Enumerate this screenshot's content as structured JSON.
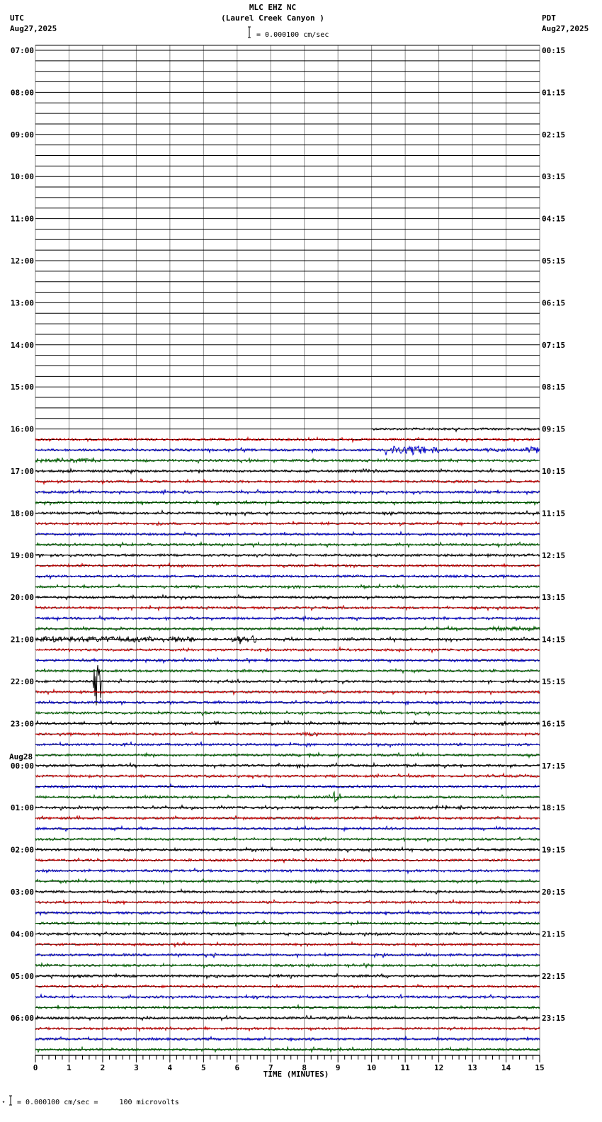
{
  "header": {
    "title": "MLC EHZ NC",
    "subtitle": "(Laurel Creek Canyon )",
    "scale": "= 0.000100 cm/sec",
    "left_tz": "UTC",
    "left_date": "Aug27,2025",
    "right_tz": "PDT",
    "right_date": "Aug27,2025"
  },
  "footer": {
    "scale_note": "= 0.000100 cm/sec =     100 microvolts",
    "mark": "⋆"
  },
  "chart_data": {
    "type": "line",
    "title": "MLC EHZ NC (Laurel Creek Canyon )",
    "xlabel": "TIME (MINUTES)",
    "xlim": [
      0,
      15
    ],
    "x_ticks": [
      "0",
      "1",
      "2",
      "3",
      "4",
      "5",
      "6",
      "7",
      "8",
      "9",
      "10",
      "11",
      "12",
      "13",
      "14",
      "15"
    ],
    "rows_per_hour": 4,
    "utc_labels": [
      "07:00",
      "08:00",
      "09:00",
      "10:00",
      "11:00",
      "12:00",
      "13:00",
      "14:00",
      "15:00",
      "16:00",
      "17:00",
      "18:00",
      "19:00",
      "20:00",
      "21:00",
      "22:00",
      "23:00",
      "00:00",
      "01:00",
      "02:00",
      "03:00",
      "04:00",
      "05:00",
      "06:00"
    ],
    "date_change_label": "Aug28",
    "pdt_labels": [
      "00:15",
      "01:15",
      "02:15",
      "03:15",
      "04:15",
      "05:15",
      "06:15",
      "07:15",
      "08:15",
      "09:15",
      "10:15",
      "11:15",
      "12:15",
      "13:15",
      "14:15",
      "15:15",
      "16:15",
      "17:15",
      "18:15",
      "19:15",
      "20:15",
      "21:15",
      "22:15",
      "23:15"
    ],
    "trace_colors": [
      "#000000",
      "#cc0000",
      "#0000cc",
      "#006600"
    ],
    "data_start": {
      "row": 36,
      "minute": 10
    },
    "events": [
      {
        "row": 38,
        "start": 10.4,
        "end": 11.6,
        "amp": 8
      },
      {
        "row": 38,
        "start": 11.8,
        "end": 12.0,
        "amp": 6
      },
      {
        "row": 38,
        "start": 13.3,
        "end": 14.2,
        "amp": 3
      },
      {
        "row": 38,
        "start": 14.5,
        "end": 15.0,
        "amp": 7
      },
      {
        "row": 39,
        "start": 0.0,
        "end": 2.0,
        "amp": 3.5
      },
      {
        "row": 45,
        "start": 3.6,
        "end": 3.8,
        "amp": 3
      },
      {
        "row": 55,
        "start": 13.4,
        "end": 15.0,
        "amp": 3.5
      },
      {
        "row": 56,
        "start": 0.0,
        "end": 4.8,
        "amp": 5
      },
      {
        "row": 56,
        "start": 5.8,
        "end": 6.6,
        "amp": 7
      },
      {
        "row": 56,
        "start": 7.3,
        "end": 7.6,
        "amp": 3
      },
      {
        "row": 60,
        "start": 1.7,
        "end": 1.95,
        "amp": 45
      },
      {
        "row": 64,
        "start": 5.3,
        "end": 5.45,
        "amp": 4
      },
      {
        "row": 64,
        "start": 13.85,
        "end": 14.0,
        "amp": 4
      },
      {
        "row": 65,
        "start": 7.9,
        "end": 8.4,
        "amp": 3.5
      },
      {
        "row": 71,
        "start": 8.85,
        "end": 9.1,
        "amp": 11
      },
      {
        "row": 75,
        "start": 0.9,
        "end": 1.5,
        "amp": 2
      }
    ]
  }
}
